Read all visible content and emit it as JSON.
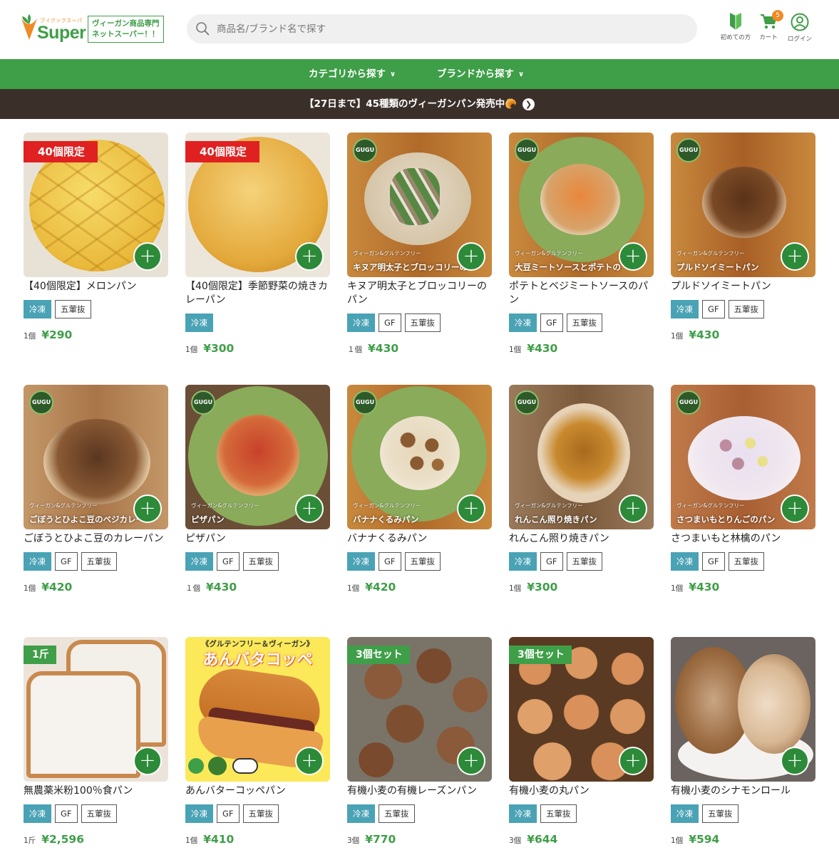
{
  "header": {
    "logo_small": "ブイクックスーパー",
    "logo_text": "Super",
    "tagline_1": "ヴィーガン商品専門",
    "tagline_2": "ネットスーパー！！",
    "search_placeholder": "商品名/ブランド名で探す",
    "beginner_label": "初めての方",
    "cart_label": "カート",
    "cart_count": "5",
    "login_label": "ログイン"
  },
  "nav": {
    "category": "カテゴリから探す",
    "brand": "ブランドから探す"
  },
  "banner": {
    "text": "【27日まで】45種類のヴィーガンパン発売中🥐"
  },
  "products": [
    {
      "name": "【40個限定】メロンパン",
      "ribbon": "40個限定",
      "tags": [
        "冷凍",
        "五葷抜"
      ],
      "qty": "1個",
      "price": "¥290"
    },
    {
      "name": "【40個限定】季節野菜の焼きカレーパン",
      "ribbon": "40個限定",
      "tags": [
        "冷凍"
      ],
      "qty": "1個",
      "price": "¥300"
    },
    {
      "name": "キヌア明太子とブロッコリーのパン",
      "brand_line": "ヴィーガン&グルテンフリー",
      "overlay": "キヌア明太子とブロッコリーの",
      "tags": [
        "冷凍",
        "GF",
        "五葷抜"
      ],
      "qty": "１個",
      "price": "¥430"
    },
    {
      "name": "ポテトとベジミートソースのパン",
      "brand_line": "ヴィーガン&グルテンフリー",
      "overlay": "大豆ミートソースとポテトの",
      "tags": [
        "冷凍",
        "GF",
        "五葷抜"
      ],
      "qty": "1個",
      "price": "¥430"
    },
    {
      "name": "プルドソイミートパン",
      "brand_line": "ヴィーガン&グルテンフリー",
      "overlay": "プルドソイミートパン",
      "tags": [
        "冷凍",
        "GF",
        "五葷抜"
      ],
      "qty": "1個",
      "price": "¥430"
    },
    {
      "name": "ごぼうとひよこ豆のカレーパン",
      "brand_line": "ヴィーガン&グルテンフリー",
      "overlay": "ごぼうとひよこ豆のベジカレー",
      "tags": [
        "冷凍",
        "GF",
        "五葷抜"
      ],
      "qty": "1個",
      "price": "¥420"
    },
    {
      "name": "ピザパン",
      "brand_line": "ヴィーガン&グルテンフリー",
      "overlay": "ピザパン",
      "tags": [
        "冷凍",
        "GF",
        "五葷抜"
      ],
      "qty": "１個",
      "price": "¥430"
    },
    {
      "name": "バナナくるみパン",
      "brand_line": "ヴィーガン&グルテンフリー",
      "overlay": "バナナくるみパン",
      "tags": [
        "冷凍",
        "GF",
        "五葷抜"
      ],
      "qty": "1個",
      "price": "¥420"
    },
    {
      "name": "れんこん照り焼きパン",
      "brand_line": "ヴィーガン&グルテンフリー",
      "overlay": "れんこん照り焼きパン",
      "tags": [
        "冷凍",
        "GF",
        "五葷抜"
      ],
      "qty": "1個",
      "price": "¥300"
    },
    {
      "name": "さつまいもと林檎のパン",
      "brand_line": "ヴィーガン&グルテンフリー",
      "overlay": "さつまいもとりんごのパン",
      "tags": [
        "冷凍",
        "GF",
        "五葷抜"
      ],
      "qty": "1個",
      "price": "¥430"
    },
    {
      "name": "無農薬米粉100％食パン",
      "ribbon": "1斤",
      "tags": [
        "冷凍",
        "GF",
        "五葷抜"
      ],
      "qty": "1斤",
      "price": "¥2,596"
    },
    {
      "name": "あんバターコッペパン",
      "poster_top": "《グルテンフリー＆ヴィーガン》",
      "poster_title": "あんバタコッペ",
      "tags": [
        "冷凍",
        "GF",
        "五葷抜"
      ],
      "qty": "1個",
      "price": "¥410"
    },
    {
      "name": "有機小麦の有機レーズンパン",
      "ribbon": "3個セット",
      "tags": [
        "冷凍",
        "五葷抜"
      ],
      "qty": "3個",
      "price": "¥770"
    },
    {
      "name": "有機小麦の丸パン",
      "ribbon": "3個セット",
      "tags": [
        "冷凍",
        "五葷抜"
      ],
      "qty": "3個",
      "price": "¥644"
    },
    {
      "name": "有機小麦のシナモンロール",
      "tags": [
        "冷凍",
        "五葷抜"
      ],
      "qty": "1個",
      "price": "¥594"
    }
  ],
  "gugu_label": "GUGU",
  "colors": {
    "brand_green": "#3f9e48",
    "banner_brown": "#3b2f2a",
    "frozen_tag": "#4aa2b5",
    "limited_red": "#e02121",
    "accent_orange": "#f08a24"
  }
}
